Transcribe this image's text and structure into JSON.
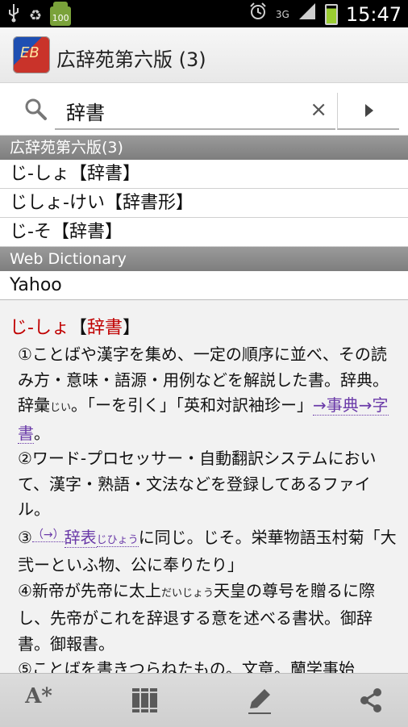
{
  "status_bar": {
    "time": "15:47",
    "battery_level": "100",
    "network": "3G",
    "icons": [
      "usb-icon",
      "recycle-icon",
      "android-battery-icon",
      "alarm-icon",
      "signal-icon",
      "battery-icon"
    ]
  },
  "title_bar": {
    "app_logo_text": "EB",
    "title": "広辞苑第六版 (3)"
  },
  "search": {
    "value": "辞書",
    "clear_label": "×"
  },
  "results": {
    "section1": "広辞苑第六版(3)",
    "items1": [
      "じ-しょ【辞書】",
      "じしょ-けい【辞書形】",
      "じ-そ【辞書】"
    ],
    "section2": "Web Dictionary",
    "items2": [
      "Yahoo"
    ]
  },
  "article": {
    "headword_kana": "じ-しょ",
    "bracket_open": "【",
    "headword_kanji": "辞書",
    "bracket_close": "】",
    "p1a": "①ことばや漢字を集め、一定の順序に並べ、その読み方・意味・語源・用例などを解説した書。辞典。辞彙",
    "p1_ruby": "じい",
    "p1b": "。「ーを引く」「英和対訳袖珍ー」",
    "p1_link": "→事典→字書",
    "p1c": "。",
    "p2": "②ワード-プロセッサー・自動翻訳システムにおいて、漢字・熟語・文法などを登録してあるファイル。",
    "p3a": "③",
    "p3_mark": "（→）",
    "p3_link": "辞表",
    "p3_ruby": "じひょう",
    "p3b": "に同じ。じそ。栄華物語玉村菊「大弐ーといふ物、公に奉りたり」",
    "p4a": "④新帝が先帝に太上",
    "p4_ruby": "だいじょう",
    "p4b": "天皇の尊号を贈るに際し、先帝がこれを辞退する意を述べる書状。御辞書。御報書。",
    "p5": "⑤ことばを書きつらねたもの。文章。蘭学事始"
  },
  "bottom_bar": {
    "font_button": "A*"
  }
}
